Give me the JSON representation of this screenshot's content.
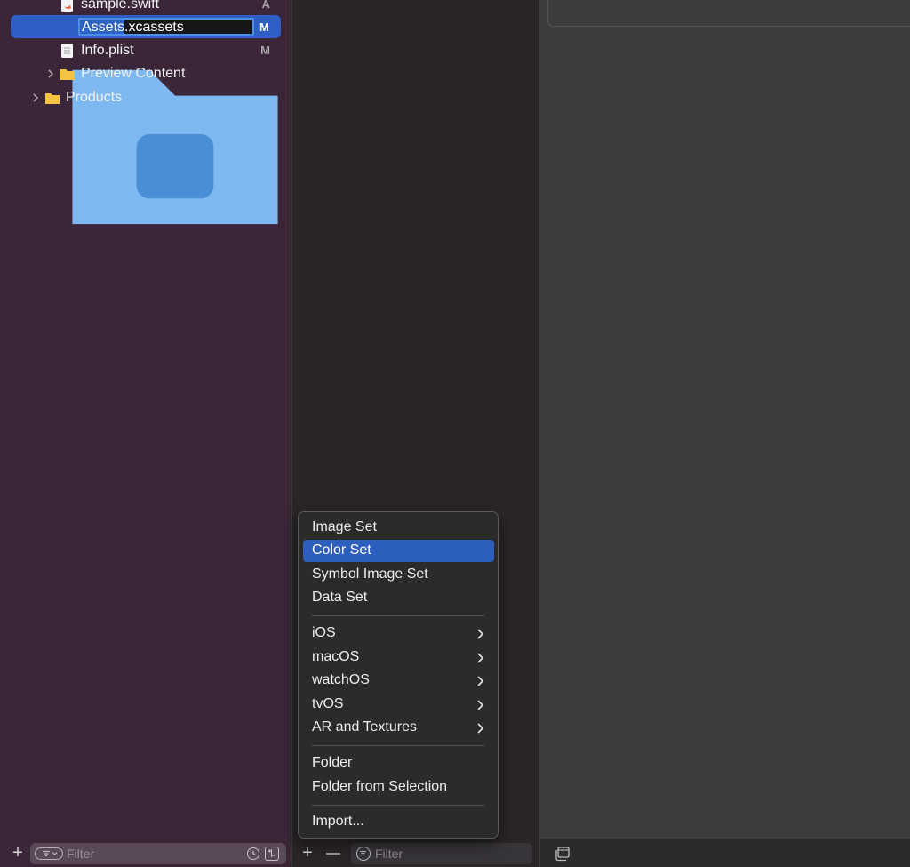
{
  "navigator": {
    "items": [
      {
        "label": "sample.swift",
        "status": "A"
      },
      {
        "label": "Assets.xcassets",
        "status": "M"
      },
      {
        "label": "Info.plist",
        "status": "M"
      },
      {
        "label": "Preview Content",
        "status": ""
      },
      {
        "label": "Products",
        "status": ""
      }
    ],
    "filter_placeholder": "Filter"
  },
  "asset_list": {
    "filter_placeholder": "Filter"
  },
  "menu": {
    "groups": [
      [
        "Image Set",
        "Color Set",
        "Symbol Image Set",
        "Data Set"
      ],
      [
        "iOS",
        "macOS",
        "watchOS",
        "tvOS",
        "AR and Textures"
      ],
      [
        "Folder",
        "Folder from Selection"
      ],
      [
        "Import..."
      ]
    ],
    "highlighted": "Color Set"
  },
  "colors": {
    "navigator_bg": "#3a2638",
    "selection": "#2f5fc4",
    "menu_highlight": "#2d5fbf",
    "folder": "#f5c242",
    "swift": "#e8623a"
  }
}
